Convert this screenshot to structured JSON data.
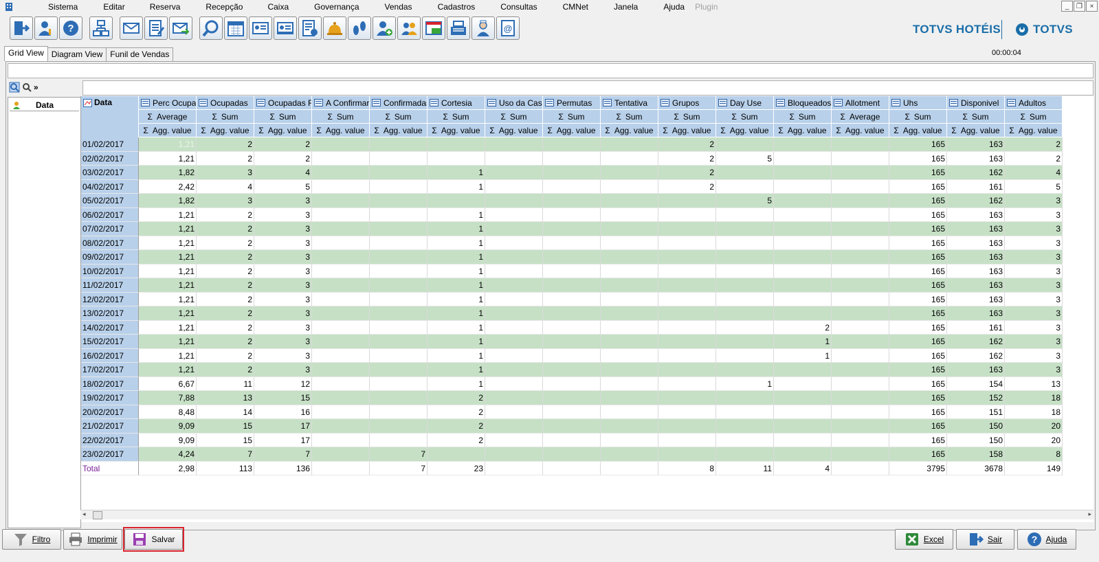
{
  "menu": [
    "Sistema",
    "Editar",
    "Reserva",
    "Recepção",
    "Caixa",
    "Governança",
    "Vendas",
    "Cadastros",
    "Consultas",
    "CMNet",
    "Janela",
    "Ajuda",
    "Plugin"
  ],
  "window_controls": [
    "_",
    "❐",
    "×"
  ],
  "brand": {
    "left": "TOTVS HOTÉIS",
    "right": "TOTVS"
  },
  "tabs": [
    "Grid View",
    "Diagram View",
    "Funil de Vendas"
  ],
  "timer": "00:00:04",
  "row_field": "Data",
  "corner_label": "Data",
  "columns": [
    {
      "name": "Perc Ocupac",
      "agg": "Average",
      "sub": "Agg. value"
    },
    {
      "name": "Ocupadas",
      "agg": "Sum",
      "sub": "Agg. value"
    },
    {
      "name": "Ocupadas Re",
      "agg": "Sum",
      "sub": "Agg. value"
    },
    {
      "name": "A Confirmar",
      "agg": "Sum",
      "sub": "Agg. value"
    },
    {
      "name": "Confirmadas",
      "agg": "Sum",
      "sub": "Agg. value"
    },
    {
      "name": "Cortesia",
      "agg": "Sum",
      "sub": "Agg. value"
    },
    {
      "name": "Uso da Casa",
      "agg": "Sum",
      "sub": "Agg. value"
    },
    {
      "name": "Permutas",
      "agg": "Sum",
      "sub": "Agg. value"
    },
    {
      "name": "Tentativa",
      "agg": "Sum",
      "sub": "Agg. value"
    },
    {
      "name": "Grupos",
      "agg": "Sum",
      "sub": "Agg. value"
    },
    {
      "name": "Day Use",
      "agg": "Sum",
      "sub": "Agg. value"
    },
    {
      "name": "Bloqueados",
      "agg": "Sum",
      "sub": "Agg. value"
    },
    {
      "name": "Allotment",
      "agg": "Average",
      "sub": "Agg. value"
    },
    {
      "name": "Uhs",
      "agg": "Sum",
      "sub": "Agg. value"
    },
    {
      "name": "Disponivel",
      "agg": "Sum",
      "sub": "Agg. value"
    },
    {
      "name": "Adultos",
      "agg": "Sum",
      "sub": "Agg. value"
    }
  ],
  "rows": [
    {
      "date": "01/02/2017",
      "v": [
        "1,21",
        "2",
        "2",
        "",
        "",
        "",
        "",
        "",
        "",
        "2",
        "",
        "",
        "",
        "165",
        "163",
        "2"
      ]
    },
    {
      "date": "02/02/2017",
      "v": [
        "1,21",
        "2",
        "2",
        "",
        "",
        "",
        "",
        "",
        "",
        "2",
        "5",
        "",
        "",
        "165",
        "163",
        "2"
      ]
    },
    {
      "date": "03/02/2017",
      "v": [
        "1,82",
        "3",
        "4",
        "",
        "",
        "1",
        "",
        "",
        "",
        "2",
        "",
        "",
        "",
        "165",
        "162",
        "4"
      ]
    },
    {
      "date": "04/02/2017",
      "v": [
        "2,42",
        "4",
        "5",
        "",
        "",
        "1",
        "",
        "",
        "",
        "2",
        "",
        "",
        "",
        "165",
        "161",
        "5"
      ]
    },
    {
      "date": "05/02/2017",
      "v": [
        "1,82",
        "3",
        "3",
        "",
        "",
        "",
        "",
        "",
        "",
        "",
        "5",
        "",
        "",
        "165",
        "162",
        "3"
      ]
    },
    {
      "date": "06/02/2017",
      "v": [
        "1,21",
        "2",
        "3",
        "",
        "",
        "1",
        "",
        "",
        "",
        "",
        "",
        "",
        "",
        "165",
        "163",
        "3"
      ]
    },
    {
      "date": "07/02/2017",
      "v": [
        "1,21",
        "2",
        "3",
        "",
        "",
        "1",
        "",
        "",
        "",
        "",
        "",
        "",
        "",
        "165",
        "163",
        "3"
      ]
    },
    {
      "date": "08/02/2017",
      "v": [
        "1,21",
        "2",
        "3",
        "",
        "",
        "1",
        "",
        "",
        "",
        "",
        "",
        "",
        "",
        "165",
        "163",
        "3"
      ]
    },
    {
      "date": "09/02/2017",
      "v": [
        "1,21",
        "2",
        "3",
        "",
        "",
        "1",
        "",
        "",
        "",
        "",
        "",
        "",
        "",
        "165",
        "163",
        "3"
      ]
    },
    {
      "date": "10/02/2017",
      "v": [
        "1,21",
        "2",
        "3",
        "",
        "",
        "1",
        "",
        "",
        "",
        "",
        "",
        "",
        "",
        "165",
        "163",
        "3"
      ]
    },
    {
      "date": "11/02/2017",
      "v": [
        "1,21",
        "2",
        "3",
        "",
        "",
        "1",
        "",
        "",
        "",
        "",
        "",
        "",
        "",
        "165",
        "163",
        "3"
      ]
    },
    {
      "date": "12/02/2017",
      "v": [
        "1,21",
        "2",
        "3",
        "",
        "",
        "1",
        "",
        "",
        "",
        "",
        "",
        "",
        "",
        "165",
        "163",
        "3"
      ]
    },
    {
      "date": "13/02/2017",
      "v": [
        "1,21",
        "2",
        "3",
        "",
        "",
        "1",
        "",
        "",
        "",
        "",
        "",
        "",
        "",
        "165",
        "163",
        "3"
      ]
    },
    {
      "date": "14/02/2017",
      "v": [
        "1,21",
        "2",
        "3",
        "",
        "",
        "1",
        "",
        "",
        "",
        "",
        "",
        "2",
        "",
        "165",
        "161",
        "3"
      ]
    },
    {
      "date": "15/02/2017",
      "v": [
        "1,21",
        "2",
        "3",
        "",
        "",
        "1",
        "",
        "",
        "",
        "",
        "",
        "1",
        "",
        "165",
        "162",
        "3"
      ]
    },
    {
      "date": "16/02/2017",
      "v": [
        "1,21",
        "2",
        "3",
        "",
        "",
        "1",
        "",
        "",
        "",
        "",
        "",
        "1",
        "",
        "165",
        "162",
        "3"
      ]
    },
    {
      "date": "17/02/2017",
      "v": [
        "1,21",
        "2",
        "3",
        "",
        "",
        "1",
        "",
        "",
        "",
        "",
        "",
        "",
        "",
        "165",
        "163",
        "3"
      ]
    },
    {
      "date": "18/02/2017",
      "v": [
        "6,67",
        "11",
        "12",
        "",
        "",
        "1",
        "",
        "",
        "",
        "",
        "1",
        "",
        "",
        "165",
        "154",
        "13"
      ]
    },
    {
      "date": "19/02/2017",
      "v": [
        "7,88",
        "13",
        "15",
        "",
        "",
        "2",
        "",
        "",
        "",
        "",
        "",
        "",
        "",
        "165",
        "152",
        "18"
      ]
    },
    {
      "date": "20/02/2017",
      "v": [
        "8,48",
        "14",
        "16",
        "",
        "",
        "2",
        "",
        "",
        "",
        "",
        "",
        "",
        "",
        "165",
        "151",
        "18"
      ]
    },
    {
      "date": "21/02/2017",
      "v": [
        "9,09",
        "15",
        "17",
        "",
        "",
        "2",
        "",
        "",
        "",
        "",
        "",
        "",
        "",
        "165",
        "150",
        "20"
      ]
    },
    {
      "date": "22/02/2017",
      "v": [
        "9,09",
        "15",
        "17",
        "",
        "",
        "2",
        "",
        "",
        "",
        "",
        "",
        "",
        "",
        "165",
        "150",
        "20"
      ]
    },
    {
      "date": "23/02/2017",
      "v": [
        "4,24",
        "7",
        "7",
        "",
        "7",
        "",
        "",
        "",
        "",
        "",
        "",
        "",
        "",
        "165",
        "158",
        "8"
      ]
    }
  ],
  "total": {
    "date": "Total",
    "v": [
      "2,98",
      "113",
      "136",
      "",
      "7",
      "23",
      "",
      "",
      "",
      "8",
      "11",
      "4",
      "",
      "3795",
      "3678",
      "149"
    ]
  },
  "buttons": {
    "filtro": "Filtro",
    "imprimir": "Imprimir",
    "salvar": "Salvar",
    "excel": "Excel",
    "sair": "Sair",
    "ajuda": "Ajuda"
  },
  "toolbar_icons": [
    "logout-icon",
    "user-key-icon",
    "help-icon",
    "network-icon",
    "mail-icon",
    "calculator-icon",
    "mail-send-icon",
    "search-icon",
    "calendar-icon",
    "card-icon",
    "card2-icon",
    "report-icon",
    "bell-icon",
    "footprints-icon",
    "add-user-icon",
    "user-group-icon",
    "money-icon",
    "cash-register-icon",
    "maid-icon",
    "contacts-icon"
  ],
  "colors": {
    "header": "#b8d0ea",
    "row_alt": "#c6e0c6",
    "brand": "#1a6ea8",
    "highlight": "#d9232c",
    "total_label": "#7a1f9a"
  }
}
